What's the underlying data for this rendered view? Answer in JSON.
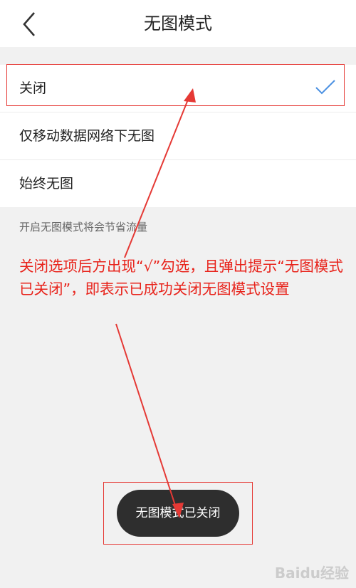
{
  "header": {
    "title": "无图模式",
    "back_icon": "chevron-left-icon"
  },
  "options": [
    {
      "label": "关闭",
      "selected": true
    },
    {
      "label": "仅移动数据网络下无图",
      "selected": false
    },
    {
      "label": "始终无图",
      "selected": false
    }
  ],
  "hint": "开启无图模式将会节省流量",
  "annotation": "关闭选项后方出现“√”勾选，且弹出提示“无图模式已关闭”，即表示已成功关闭无图模式设置",
  "toast": "无图模式已关闭",
  "watermark": "Baidu经验",
  "colors": {
    "accent": "#4a90e2",
    "annotation": "#e8231b",
    "toast_bg": "#2e2e2e"
  }
}
